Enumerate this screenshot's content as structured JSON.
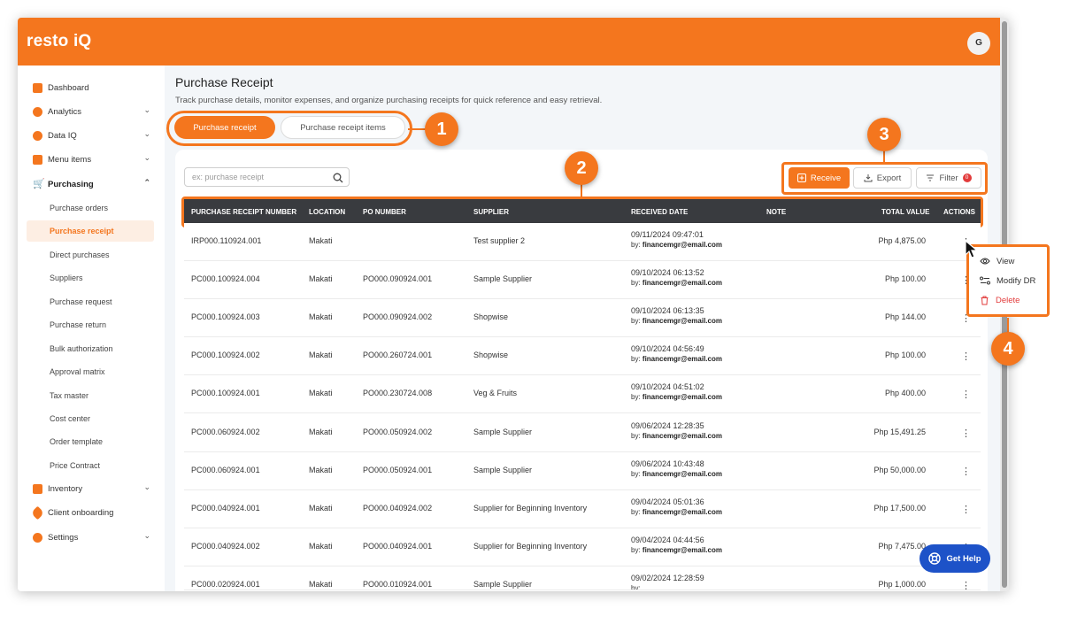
{
  "app": {
    "logo": "resto iQ",
    "avatar_initial": "G"
  },
  "colors": {
    "brand": "#f4761e",
    "header_dark": "#393b3f",
    "danger": "#e23b3b",
    "help": "#1d52c8"
  },
  "sidebar": {
    "items": [
      {
        "label": "Dashboard",
        "icon": "dashboard-icon"
      },
      {
        "label": "Analytics",
        "icon": "pie-chart-icon"
      },
      {
        "label": "Data IQ",
        "icon": "pie-chart-icon"
      },
      {
        "label": "Menu items",
        "icon": "grid-icon"
      },
      {
        "label": "Purchasing",
        "icon": "cart-icon"
      }
    ],
    "purchasing_sub": [
      "Purchase orders",
      "Purchase receipt",
      "Direct purchases",
      "Suppliers",
      "Purchase request",
      "Purchase return",
      "Bulk authorization",
      "Approval matrix",
      "Tax master",
      "Cost center",
      "Order template",
      "Price Contract"
    ],
    "bottom_items": [
      {
        "label": "Inventory",
        "icon": "box-icon"
      },
      {
        "label": "Client onboarding",
        "icon": "rocket-icon"
      },
      {
        "label": "Settings",
        "icon": "gear-icon"
      }
    ]
  },
  "page": {
    "title": "Purchase Receipt",
    "description": "Track purchase details, monitor expenses, and organize purchasing receipts for quick reference and easy retrieval."
  },
  "tabs": {
    "active": "Purchase receipt",
    "inactive": "Purchase receipt items"
  },
  "search": {
    "placeholder": "ex: purchase receipt"
  },
  "toolbar": {
    "receive": "Receive",
    "export": "Export",
    "filter": "Filter",
    "filter_count": "0"
  },
  "table": {
    "headers": [
      "PURCHASE RECEIPT NUMBER",
      "LOCATION",
      "PO NUMBER",
      "SUPPLIER",
      "RECEIVED DATE",
      "NOTE",
      "TOTAL VALUE",
      "ACTIONS"
    ],
    "by_prefix": "by:",
    "rows": [
      {
        "number": "IRP000.110924.001",
        "location": "Makati",
        "po": "",
        "supplier": "Test supplier 2",
        "date": "09/11/2024 09:47:01",
        "by": "financemgr@email.com",
        "total": "Php 4,875.00"
      },
      {
        "number": "PC000.100924.004",
        "location": "Makati",
        "po": "PO000.090924.001",
        "supplier": "Sample Supplier",
        "date": "09/10/2024 06:13:52",
        "by": "financemgr@email.com",
        "total": "Php 100.00"
      },
      {
        "number": "PC000.100924.003",
        "location": "Makati",
        "po": "PO000.090924.002",
        "supplier": "Shopwise",
        "date": "09/10/2024 06:13:35",
        "by": "financemgr@email.com",
        "total": "Php 144.00"
      },
      {
        "number": "PC000.100924.002",
        "location": "Makati",
        "po": "PO000.260724.001",
        "supplier": "Shopwise",
        "date": "09/10/2024 04:56:49",
        "by": "financemgr@email.com",
        "total": "Php 100.00"
      },
      {
        "number": "PC000.100924.001",
        "location": "Makati",
        "po": "PO000.230724.008",
        "supplier": "Veg & Fruits",
        "date": "09/10/2024 04:51:02",
        "by": "financemgr@email.com",
        "total": "Php 400.00"
      },
      {
        "number": "PC000.060924.002",
        "location": "Makati",
        "po": "PO000.050924.002",
        "supplier": "Sample Supplier",
        "date": "09/06/2024 12:28:35",
        "by": "financemgr@email.com",
        "total": "Php 15,491.25"
      },
      {
        "number": "PC000.060924.001",
        "location": "Makati",
        "po": "PO000.050924.001",
        "supplier": "Sample Supplier",
        "date": "09/06/2024 10:43:48",
        "by": "financemgr@email.com",
        "total": "Php 50,000.00"
      },
      {
        "number": "PC000.040924.001",
        "location": "Makati",
        "po": "PO000.040924.002",
        "supplier": "Supplier for Beginning Inventory",
        "date": "09/04/2024 05:01:36",
        "by": "financemgr@email.com",
        "total": "Php 17,500.00"
      },
      {
        "number": "PC000.040924.002",
        "location": "Makati",
        "po": "PO000.040924.001",
        "supplier": "Supplier for Beginning Inventory",
        "date": "09/04/2024 04:44:56",
        "by": "financemgr@email.com",
        "total": "Php 7,475.00"
      },
      {
        "number": "PC000.020924.001",
        "location": "Makati",
        "po": "PO000.010924.001",
        "supplier": "Sample Supplier",
        "date": "09/02/2024 12:28:59",
        "by": "",
        "total": "Php 1,000.00"
      }
    ]
  },
  "row_menu": {
    "view": "View",
    "modify": "Modify DR",
    "delete": "Delete"
  },
  "callouts": [
    "1",
    "2",
    "3",
    "4"
  ],
  "help": {
    "label": "Get Help"
  }
}
